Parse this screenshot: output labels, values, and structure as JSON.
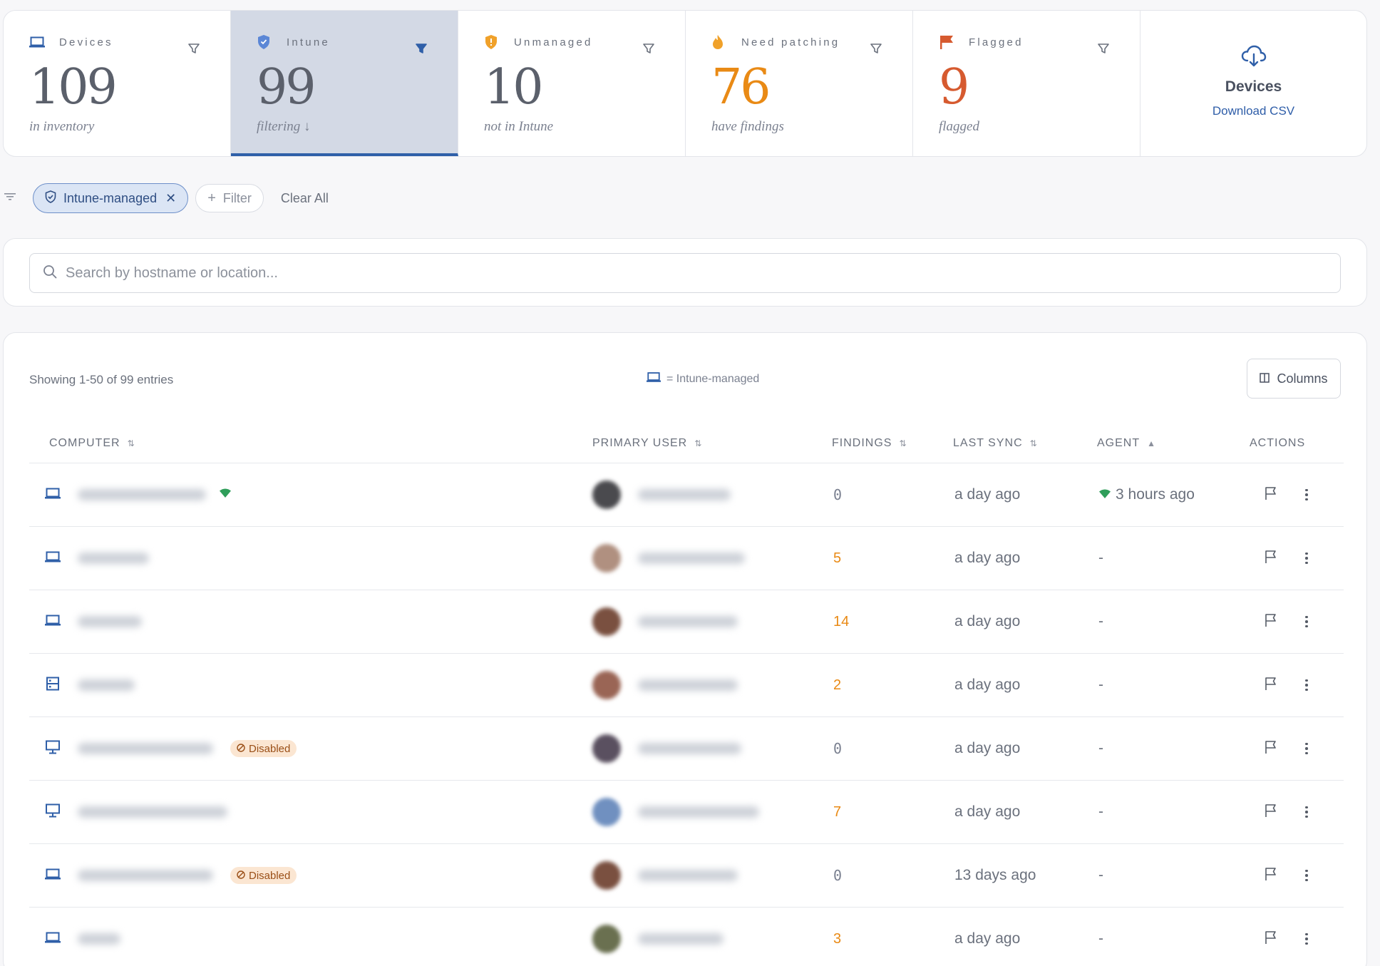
{
  "stats": [
    {
      "label": "Devices",
      "icon": "laptop-icon",
      "value": "109",
      "sub": "in inventory"
    },
    {
      "label": "Intune",
      "icon": "shield-icon",
      "value": "99",
      "sub": "filtering ↓"
    },
    {
      "label": "Unmanaged",
      "icon": "shield-alert-icon",
      "value": "10",
      "sub": "not in Intune"
    },
    {
      "label": "Need patching",
      "icon": "flame-icon",
      "value": "76",
      "sub": "have findings"
    },
    {
      "label": "Flagged",
      "icon": "flag-icon",
      "value": "9",
      "sub": "flagged"
    }
  ],
  "download": {
    "title": "Devices",
    "link": "Download CSV",
    "icon": "cloud-download-icon"
  },
  "filters": {
    "active_chip": "Intune-managed",
    "add_label": "Filter",
    "clear_label": "Clear All"
  },
  "search": {
    "placeholder": "Search by hostname or location..."
  },
  "table": {
    "showing": "Showing 1-50 of 99 entries",
    "legend": "= Intune-managed",
    "columns_label": "Columns",
    "headers": {
      "computer": "COMPUTER",
      "primary_user": "PRIMARY USER",
      "findings": "FINDINGS",
      "last_sync": "LAST SYNC",
      "agent": "AGENT",
      "actions": "ACTIONS"
    },
    "disabled_label": "Disabled",
    "rows": [
      {
        "device_icon": "laptop-icon",
        "findings": "0",
        "last_sync": "a day ago",
        "agent": "3 hours ago"
      },
      {
        "device_icon": "laptop-icon",
        "findings": "5",
        "last_sync": "a day ago",
        "agent": "-"
      },
      {
        "device_icon": "laptop-icon",
        "findings": "14",
        "last_sync": "a day ago",
        "agent": "-"
      },
      {
        "device_icon": "server-icon",
        "findings": "2",
        "last_sync": "a day ago",
        "agent": "-"
      },
      {
        "device_icon": "desktop-icon",
        "findings": "0",
        "last_sync": "a day ago",
        "agent": "-"
      },
      {
        "device_icon": "desktop-icon",
        "findings": "7",
        "last_sync": "a day ago",
        "agent": "-"
      },
      {
        "device_icon": "laptop-icon",
        "findings": "0",
        "last_sync": "13 days ago",
        "agent": "-"
      },
      {
        "device_icon": "laptop-icon",
        "findings": "3",
        "last_sync": "a day ago",
        "agent": "-"
      }
    ]
  },
  "colors": {
    "accent": "#2f5fa8",
    "warning": "#e98a15",
    "danger": "#d65a2f",
    "success": "#2f9e5a"
  }
}
